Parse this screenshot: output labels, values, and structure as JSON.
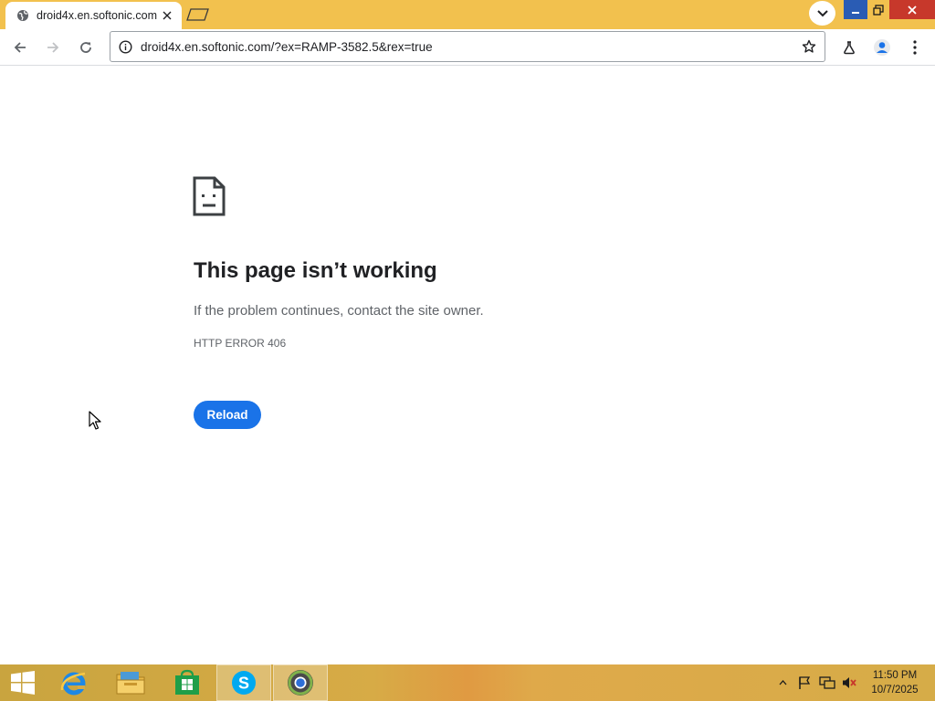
{
  "browser": {
    "tab": {
      "title": "droid4x.en.softonic.com",
      "favicon": "globe-icon"
    },
    "address_bar": {
      "url": "droid4x.en.softonic.com/?ex=RAMP-3582.5&rex=true"
    }
  },
  "error_page": {
    "title": "This page isn’t working",
    "description": "If the problem continues, contact the site owner.",
    "error_code": "HTTP ERROR 406",
    "reload_label": "Reload"
  },
  "taskbar": {
    "apps": [
      "windows-start-icon",
      "internet-explorer-icon",
      "file-explorer-icon",
      "store-icon",
      "skype-icon",
      "chrome-canary-icon"
    ],
    "clock": {
      "time": "11:50 PM",
      "date": "10/7/2025"
    }
  },
  "colors": {
    "tab_strip": "#f2c14e",
    "accent_blue": "#1a73e8",
    "close_red": "#c7382b"
  }
}
